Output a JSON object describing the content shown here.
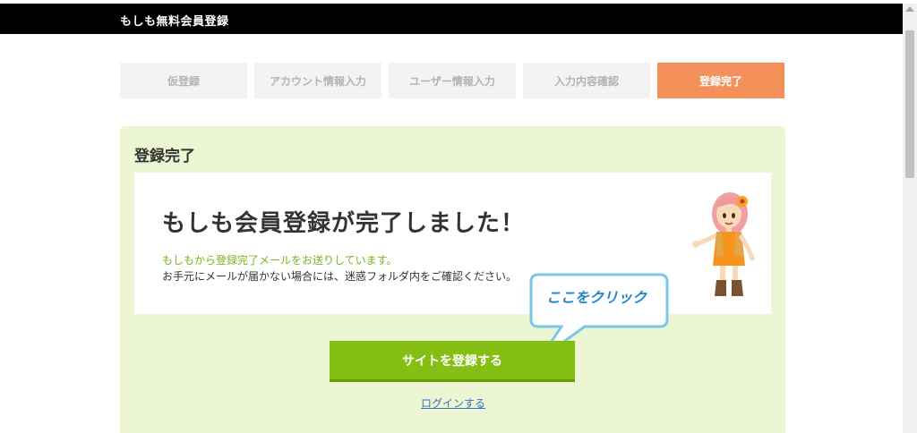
{
  "header": {
    "title": "もしも無料会員登録"
  },
  "steps": [
    {
      "label": "仮登録"
    },
    {
      "label": "アカウント情報入力"
    },
    {
      "label": "ユーザー情報入力"
    },
    {
      "label": "入力内容確認"
    },
    {
      "label": "登録完了",
      "active": true
    }
  ],
  "panel": {
    "title": "登録完了",
    "heading": "もしも会員登録が完了しました！",
    "note": "もしもから登録完了メールをお送りしています。",
    "text": "お手元にメールが届かない場合には、迷惑フォルダ内をご確認ください。"
  },
  "callout": {
    "text": "ここをクリック"
  },
  "actions": {
    "register_label": "サイトを登録する",
    "login_label": "ログインする"
  },
  "colors": {
    "accent_orange": "#f4915a",
    "panel_green": "#ecf6d2",
    "button_green": "#86bf13",
    "note_green": "#7bb51c",
    "link_blue": "#3a6fc4"
  }
}
